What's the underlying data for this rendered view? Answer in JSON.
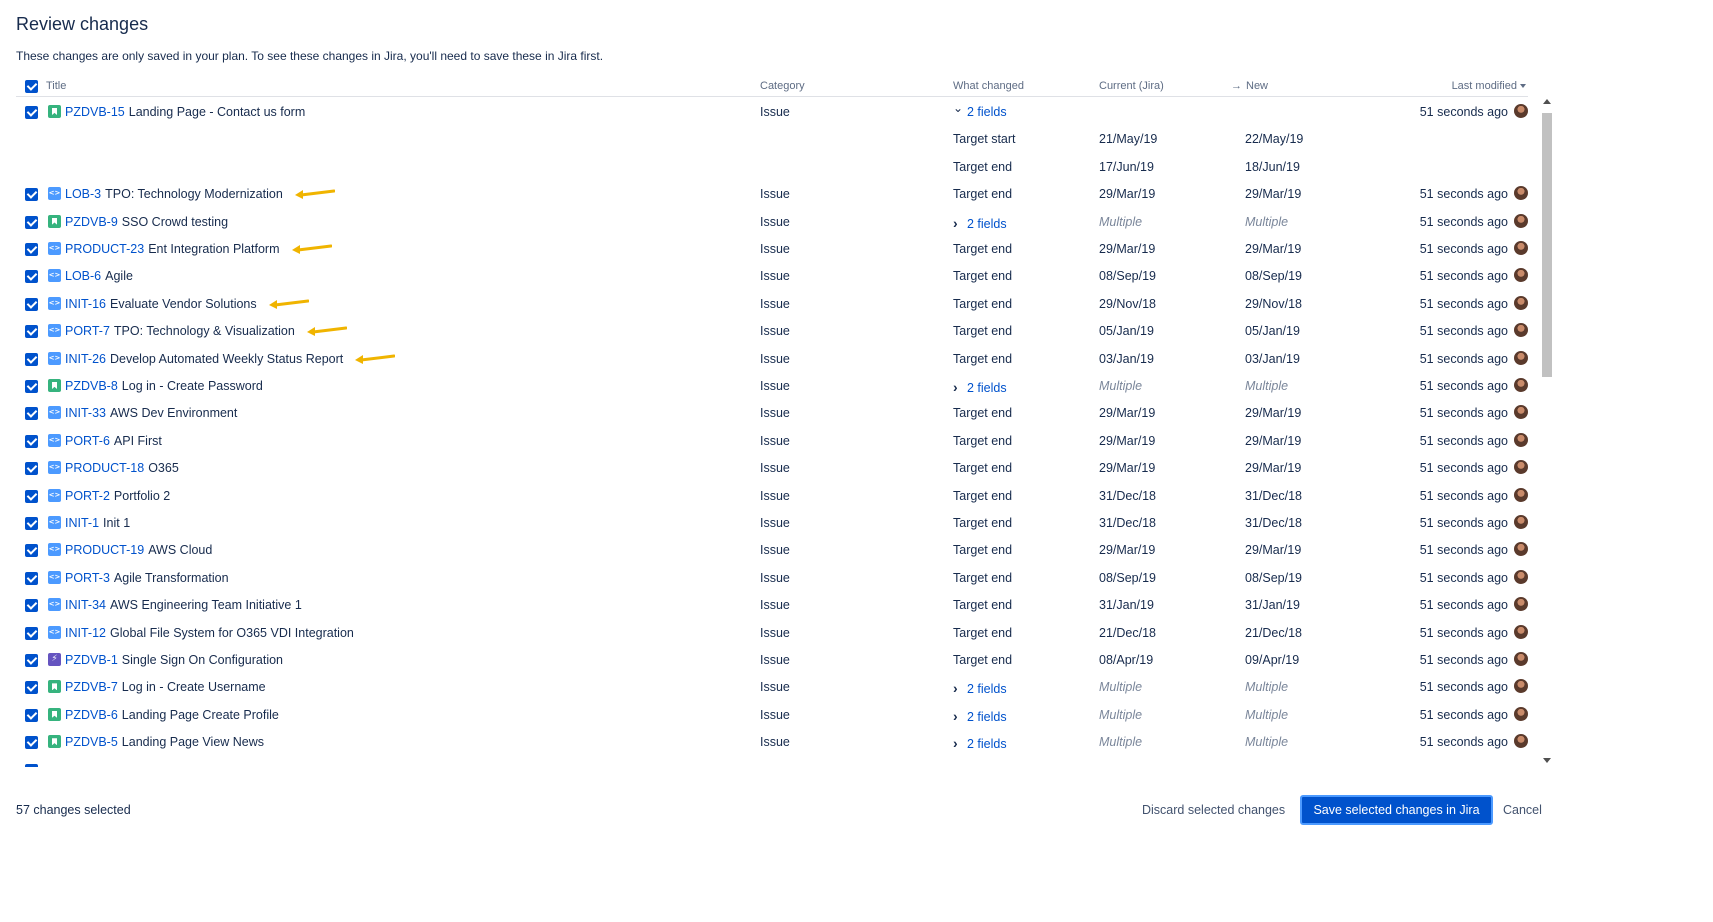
{
  "page": {
    "title": "Review changes",
    "subtitle": "These changes are only saved in your plan. To see these changes in Jira, you'll need to save these in Jira first."
  },
  "table": {
    "headers": {
      "title": "Title",
      "category": "Category",
      "what_changed": "What changed",
      "current": "Current (Jira)",
      "new_arrow": "→",
      "new": "New",
      "last_modified": "Last modified"
    },
    "rows": [
      {
        "key": "PZDVB-15",
        "summary": "Landing Page - Contact us form",
        "icon": "story-icon",
        "category": "Issue",
        "what": "2 fields",
        "expandable": true,
        "expanded": true,
        "current": "",
        "new": "",
        "modified": "51 seconds ago",
        "sub": [
          {
            "field": "Target start",
            "current": "21/May/19",
            "new": "22/May/19"
          },
          {
            "field": "Target end",
            "current": "17/Jun/19",
            "new": "18/Jun/19"
          }
        ]
      },
      {
        "key": "LOB-3",
        "summary": "TPO: Technology Modernization",
        "icon": "initiative-icon",
        "category": "Issue",
        "what": "Target end",
        "current": "29/Mar/19",
        "new": "29/Mar/19",
        "modified": "51 seconds ago",
        "arrow": true
      },
      {
        "key": "PZDVB-9",
        "summary": "SSO Crowd testing",
        "icon": "story-icon",
        "category": "Issue",
        "what": "2 fields",
        "expandable": true,
        "current": "Multiple",
        "new": "Multiple",
        "multiple": true,
        "modified": "51 seconds ago"
      },
      {
        "key": "PRODUCT-23",
        "summary": "Ent Integration Platform",
        "icon": "initiative-icon",
        "category": "Issue",
        "what": "Target end",
        "current": "29/Mar/19",
        "new": "29/Mar/19",
        "modified": "51 seconds ago",
        "arrow": true
      },
      {
        "key": "LOB-6",
        "summary": "Agile",
        "icon": "initiative-icon",
        "category": "Issue",
        "what": "Target end",
        "current": "08/Sep/19",
        "new": "08/Sep/19",
        "modified": "51 seconds ago"
      },
      {
        "key": "INIT-16",
        "summary": "Evaluate Vendor Solutions",
        "icon": "initiative-icon",
        "category": "Issue",
        "what": "Target end",
        "current": "29/Nov/18",
        "new": "29/Nov/18",
        "modified": "51 seconds ago",
        "arrow": true
      },
      {
        "key": "PORT-7",
        "summary": "TPO: Technology & Visualization",
        "icon": "initiative-icon",
        "category": "Issue",
        "what": "Target end",
        "current": "05/Jan/19",
        "new": "05/Jan/19",
        "modified": "51 seconds ago",
        "arrow": true
      },
      {
        "key": "INIT-26",
        "summary": "Develop Automated Weekly Status Report",
        "icon": "initiative-icon",
        "category": "Issue",
        "what": "Target end",
        "current": "03/Jan/19",
        "new": "03/Jan/19",
        "modified": "51 seconds ago",
        "arrow": true
      },
      {
        "key": "PZDVB-8",
        "summary": "Log in - Create Password",
        "icon": "story-icon",
        "category": "Issue",
        "what": "2 fields",
        "expandable": true,
        "current": "Multiple",
        "new": "Multiple",
        "multiple": true,
        "modified": "51 seconds ago"
      },
      {
        "key": "INIT-33",
        "summary": "AWS Dev Environment",
        "icon": "initiative-icon",
        "category": "Issue",
        "what": "Target end",
        "current": "29/Mar/19",
        "new": "29/Mar/19",
        "modified": "51 seconds ago"
      },
      {
        "key": "PORT-6",
        "summary": "API First",
        "icon": "initiative-icon",
        "category": "Issue",
        "what": "Target end",
        "current": "29/Mar/19",
        "new": "29/Mar/19",
        "modified": "51 seconds ago"
      },
      {
        "key": "PRODUCT-18",
        "summary": "O365",
        "icon": "initiative-icon",
        "category": "Issue",
        "what": "Target end",
        "current": "29/Mar/19",
        "new": "29/Mar/19",
        "modified": "51 seconds ago"
      },
      {
        "key": "PORT-2",
        "summary": "Portfolio 2",
        "icon": "initiative-icon",
        "category": "Issue",
        "what": "Target end",
        "current": "31/Dec/18",
        "new": "31/Dec/18",
        "modified": "51 seconds ago"
      },
      {
        "key": "INIT-1",
        "summary": "Init 1",
        "icon": "initiative-icon",
        "category": "Issue",
        "what": "Target end",
        "current": "31/Dec/18",
        "new": "31/Dec/18",
        "modified": "51 seconds ago"
      },
      {
        "key": "PRODUCT-19",
        "summary": "AWS Cloud",
        "icon": "initiative-icon",
        "category": "Issue",
        "what": "Target end",
        "current": "29/Mar/19",
        "new": "29/Mar/19",
        "modified": "51 seconds ago"
      },
      {
        "key": "PORT-3",
        "summary": "Agile Transformation",
        "icon": "initiative-icon",
        "category": "Issue",
        "what": "Target end",
        "current": "08/Sep/19",
        "new": "08/Sep/19",
        "modified": "51 seconds ago"
      },
      {
        "key": "INIT-34",
        "summary": "AWS Engineering Team Initiative 1",
        "icon": "initiative-icon",
        "category": "Issue",
        "what": "Target end",
        "current": "31/Jan/19",
        "new": "31/Jan/19",
        "modified": "51 seconds ago"
      },
      {
        "key": "INIT-12",
        "summary": "Global File System for O365 VDI Integration",
        "icon": "initiative-icon",
        "category": "Issue",
        "what": "Target end",
        "current": "21/Dec/18",
        "new": "21/Dec/18",
        "modified": "51 seconds ago"
      },
      {
        "key": "PZDVB-1",
        "summary": "Single Sign On Configuration",
        "icon": "epic-icon",
        "category": "Issue",
        "what": "Target end",
        "current": "08/Apr/19",
        "new": "09/Apr/19",
        "modified": "51 seconds ago"
      },
      {
        "key": "PZDVB-7",
        "summary": "Log in - Create Username",
        "icon": "story-icon",
        "category": "Issue",
        "what": "2 fields",
        "expandable": true,
        "current": "Multiple",
        "new": "Multiple",
        "multiple": true,
        "modified": "51 seconds ago"
      },
      {
        "key": "PZDVB-6",
        "summary": "Landing Page Create Profile",
        "icon": "story-icon",
        "category": "Issue",
        "what": "2 fields",
        "expandable": true,
        "current": "Multiple",
        "new": "Multiple",
        "multiple": true,
        "modified": "51 seconds ago"
      },
      {
        "key": "PZDVB-5",
        "summary": "Landing Page View News",
        "icon": "story-icon",
        "category": "Issue",
        "what": "2 fields",
        "expandable": true,
        "current": "Multiple",
        "new": "Multiple",
        "multiple": true,
        "modified": "51 seconds ago"
      }
    ]
  },
  "footer": {
    "count": "57 changes selected",
    "discard": "Discard selected changes",
    "save": "Save selected changes in Jira",
    "cancel": "Cancel"
  },
  "colors": {
    "brand": "#0052cc",
    "annotation_arrow": "#f0b400"
  }
}
